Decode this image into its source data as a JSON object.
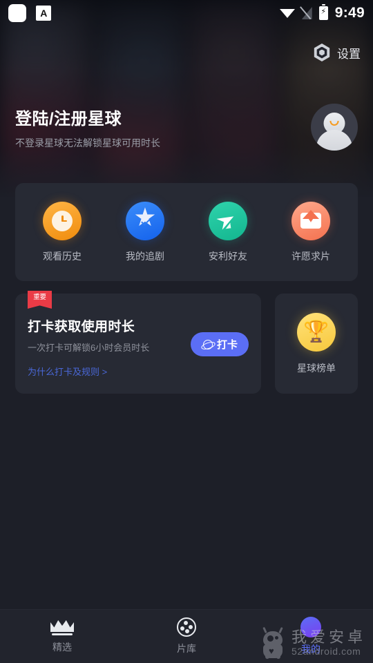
{
  "statusbar": {
    "notification_icon": "rounded-square-icon",
    "app_badge_label": "A",
    "wifi_icon": "wifi-icon",
    "signal_icon": "no-signal-icon",
    "battery_icon": "battery-charging-icon",
    "time": "9:49"
  },
  "header": {
    "settings_label": "设置",
    "settings_icon": "hex-gear-icon",
    "account_title": "登陆/注册星球",
    "account_subtitle": "不登录星球无法解锁星球可用时长",
    "avatar_icon": "default-avatar-icon"
  },
  "quick_actions": [
    {
      "label": "观看历史",
      "icon": "clock-icon",
      "color": "#f08c0d"
    },
    {
      "label": "我的追剧",
      "icon": "star-check-icon",
      "color": "#1462ec"
    },
    {
      "label": "安利好友",
      "icon": "paper-plane-icon",
      "color": "#13b68f"
    },
    {
      "label": "许愿求片",
      "icon": "envelope-heart-icon",
      "color": "#f4714f"
    }
  ],
  "checkin_card": {
    "badge": "重要",
    "badge_color": "#ea3b46",
    "title": "打卡获取使用时长",
    "subtitle": "一次打卡可解锁6小时会员时长",
    "button_label": "打卡",
    "button_icon": "planet-icon",
    "button_color": "#5b6ef5",
    "link_label": "为什么打卡及规则 >",
    "link_color": "#4a68d8"
  },
  "rank_card": {
    "label": "星球榜单",
    "icon": "trophy-icon",
    "color": "#f7c83c"
  },
  "bottom_nav": {
    "active": "我的",
    "items": [
      {
        "label": "精选",
        "icon": "crown-icon",
        "active": false
      },
      {
        "label": "片库",
        "icon": "film-reel-icon",
        "active": false
      },
      {
        "label": "我的",
        "icon": "profile-circle-icon",
        "active": true
      }
    ]
  },
  "watermark": {
    "brand_cn": "我爱安卓",
    "brand_url": "52android.com",
    "mascot_icon": "robot-mascot-icon"
  }
}
